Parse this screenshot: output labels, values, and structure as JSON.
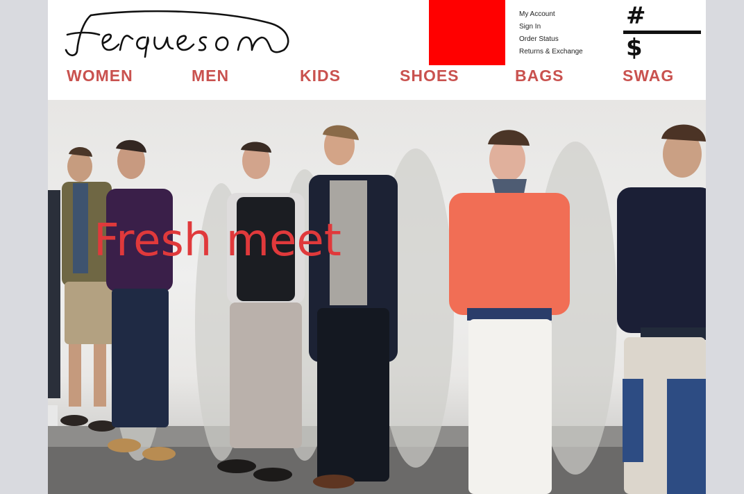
{
  "brand": {
    "logo_text": "Ferqueson"
  },
  "account_links": [
    "My Account",
    "Sign In",
    "Order Status",
    "Returns & Exchange"
  ],
  "cart": {
    "top_symbol": "#",
    "bottom_symbol": "$"
  },
  "nav": {
    "items": [
      "WOMEN",
      "MEN",
      "KIDS",
      "SHOES",
      "BAGS",
      "SWAG"
    ]
  },
  "hero": {
    "headline": "Fresh meet"
  },
  "colors": {
    "nav": "#c9524f",
    "promo_block": "#ff0000",
    "headline": "#e0393b",
    "page_background": "#d9dadf"
  }
}
